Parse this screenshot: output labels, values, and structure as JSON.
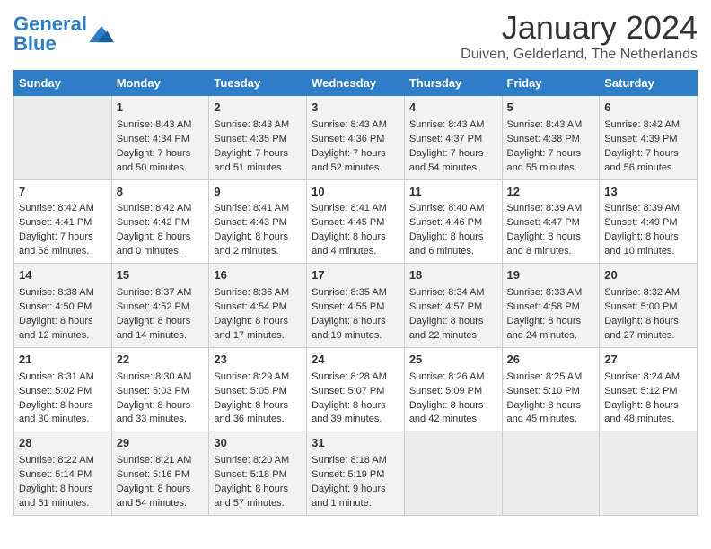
{
  "header": {
    "logo_general": "General",
    "logo_blue": "Blue",
    "month_title": "January 2024",
    "location": "Duiven, Gelderland, The Netherlands"
  },
  "days_of_week": [
    "Sunday",
    "Monday",
    "Tuesday",
    "Wednesday",
    "Thursday",
    "Friday",
    "Saturday"
  ],
  "weeks": [
    [
      {
        "day": "",
        "empty": true
      },
      {
        "day": "1",
        "sunrise": "Sunrise: 8:43 AM",
        "sunset": "Sunset: 4:34 PM",
        "daylight": "Daylight: 7 hours and 50 minutes."
      },
      {
        "day": "2",
        "sunrise": "Sunrise: 8:43 AM",
        "sunset": "Sunset: 4:35 PM",
        "daylight": "Daylight: 7 hours and 51 minutes."
      },
      {
        "day": "3",
        "sunrise": "Sunrise: 8:43 AM",
        "sunset": "Sunset: 4:36 PM",
        "daylight": "Daylight: 7 hours and 52 minutes."
      },
      {
        "day": "4",
        "sunrise": "Sunrise: 8:43 AM",
        "sunset": "Sunset: 4:37 PM",
        "daylight": "Daylight: 7 hours and 54 minutes."
      },
      {
        "day": "5",
        "sunrise": "Sunrise: 8:43 AM",
        "sunset": "Sunset: 4:38 PM",
        "daylight": "Daylight: 7 hours and 55 minutes."
      },
      {
        "day": "6",
        "sunrise": "Sunrise: 8:42 AM",
        "sunset": "Sunset: 4:39 PM",
        "daylight": "Daylight: 7 hours and 56 minutes."
      }
    ],
    [
      {
        "day": "7",
        "sunrise": "Sunrise: 8:42 AM",
        "sunset": "Sunset: 4:41 PM",
        "daylight": "Daylight: 7 hours and 58 minutes."
      },
      {
        "day": "8",
        "sunrise": "Sunrise: 8:42 AM",
        "sunset": "Sunset: 4:42 PM",
        "daylight": "Daylight: 8 hours and 0 minutes."
      },
      {
        "day": "9",
        "sunrise": "Sunrise: 8:41 AM",
        "sunset": "Sunset: 4:43 PM",
        "daylight": "Daylight: 8 hours and 2 minutes."
      },
      {
        "day": "10",
        "sunrise": "Sunrise: 8:41 AM",
        "sunset": "Sunset: 4:45 PM",
        "daylight": "Daylight: 8 hours and 4 minutes."
      },
      {
        "day": "11",
        "sunrise": "Sunrise: 8:40 AM",
        "sunset": "Sunset: 4:46 PM",
        "daylight": "Daylight: 8 hours and 6 minutes."
      },
      {
        "day": "12",
        "sunrise": "Sunrise: 8:39 AM",
        "sunset": "Sunset: 4:47 PM",
        "daylight": "Daylight: 8 hours and 8 minutes."
      },
      {
        "day": "13",
        "sunrise": "Sunrise: 8:39 AM",
        "sunset": "Sunset: 4:49 PM",
        "daylight": "Daylight: 8 hours and 10 minutes."
      }
    ],
    [
      {
        "day": "14",
        "sunrise": "Sunrise: 8:38 AM",
        "sunset": "Sunset: 4:50 PM",
        "daylight": "Daylight: 8 hours and 12 minutes."
      },
      {
        "day": "15",
        "sunrise": "Sunrise: 8:37 AM",
        "sunset": "Sunset: 4:52 PM",
        "daylight": "Daylight: 8 hours and 14 minutes."
      },
      {
        "day": "16",
        "sunrise": "Sunrise: 8:36 AM",
        "sunset": "Sunset: 4:54 PM",
        "daylight": "Daylight: 8 hours and 17 minutes."
      },
      {
        "day": "17",
        "sunrise": "Sunrise: 8:35 AM",
        "sunset": "Sunset: 4:55 PM",
        "daylight": "Daylight: 8 hours and 19 minutes."
      },
      {
        "day": "18",
        "sunrise": "Sunrise: 8:34 AM",
        "sunset": "Sunset: 4:57 PM",
        "daylight": "Daylight: 8 hours and 22 minutes."
      },
      {
        "day": "19",
        "sunrise": "Sunrise: 8:33 AM",
        "sunset": "Sunset: 4:58 PM",
        "daylight": "Daylight: 8 hours and 24 minutes."
      },
      {
        "day": "20",
        "sunrise": "Sunrise: 8:32 AM",
        "sunset": "Sunset: 5:00 PM",
        "daylight": "Daylight: 8 hours and 27 minutes."
      }
    ],
    [
      {
        "day": "21",
        "sunrise": "Sunrise: 8:31 AM",
        "sunset": "Sunset: 5:02 PM",
        "daylight": "Daylight: 8 hours and 30 minutes."
      },
      {
        "day": "22",
        "sunrise": "Sunrise: 8:30 AM",
        "sunset": "Sunset: 5:03 PM",
        "daylight": "Daylight: 8 hours and 33 minutes."
      },
      {
        "day": "23",
        "sunrise": "Sunrise: 8:29 AM",
        "sunset": "Sunset: 5:05 PM",
        "daylight": "Daylight: 8 hours and 36 minutes."
      },
      {
        "day": "24",
        "sunrise": "Sunrise: 8:28 AM",
        "sunset": "Sunset: 5:07 PM",
        "daylight": "Daylight: 8 hours and 39 minutes."
      },
      {
        "day": "25",
        "sunrise": "Sunrise: 8:26 AM",
        "sunset": "Sunset: 5:09 PM",
        "daylight": "Daylight: 8 hours and 42 minutes."
      },
      {
        "day": "26",
        "sunrise": "Sunrise: 8:25 AM",
        "sunset": "Sunset: 5:10 PM",
        "daylight": "Daylight: 8 hours and 45 minutes."
      },
      {
        "day": "27",
        "sunrise": "Sunrise: 8:24 AM",
        "sunset": "Sunset: 5:12 PM",
        "daylight": "Daylight: 8 hours and 48 minutes."
      }
    ],
    [
      {
        "day": "28",
        "sunrise": "Sunrise: 8:22 AM",
        "sunset": "Sunset: 5:14 PM",
        "daylight": "Daylight: 8 hours and 51 minutes."
      },
      {
        "day": "29",
        "sunrise": "Sunrise: 8:21 AM",
        "sunset": "Sunset: 5:16 PM",
        "daylight": "Daylight: 8 hours and 54 minutes."
      },
      {
        "day": "30",
        "sunrise": "Sunrise: 8:20 AM",
        "sunset": "Sunset: 5:18 PM",
        "daylight": "Daylight: 8 hours and 57 minutes."
      },
      {
        "day": "31",
        "sunrise": "Sunrise: 8:18 AM",
        "sunset": "Sunset: 5:19 PM",
        "daylight": "Daylight: 9 hours and 1 minute."
      },
      {
        "day": "",
        "empty": true
      },
      {
        "day": "",
        "empty": true
      },
      {
        "day": "",
        "empty": true
      }
    ]
  ]
}
